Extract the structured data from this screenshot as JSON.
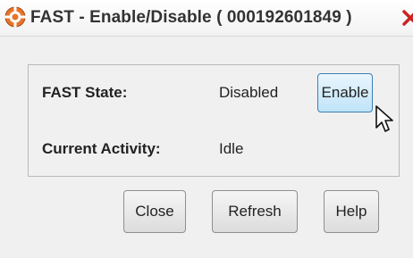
{
  "window": {
    "title": "FAST - Enable/Disable ( 000192601849 )"
  },
  "panel": {
    "fast_state_label": "FAST State:",
    "fast_state_value": "Disabled",
    "current_activity_label": "Current Activity:",
    "current_activity_value": "Idle",
    "enable_button_label": "Enable"
  },
  "footer": {
    "close_label": "Close",
    "refresh_label": "Refresh",
    "help_label": "Help"
  },
  "icons": {
    "app": "fast-app-icon",
    "close": "close-x-icon",
    "cursor": "mouse-pointer-icon"
  },
  "colors": {
    "close_x": "#cc2222",
    "app_icon_fill": "#e8742a"
  }
}
